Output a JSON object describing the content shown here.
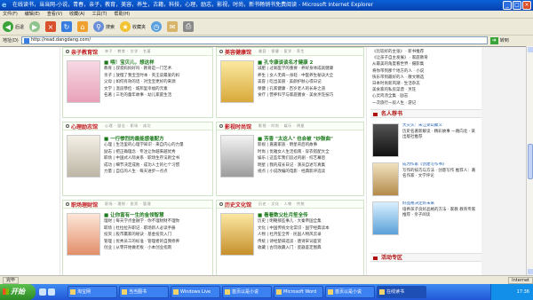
{
  "window": {
    "title": "在线读书，当当网-小说，青春，亲子，教育，美容，养生，古籍，科技，心理，励志，影视，时尚，新书畅销书免费阅读 - Microsoft Internet Explorer",
    "icon_label": "e",
    "min": "_",
    "max": "□",
    "close": "×"
  },
  "menu": [
    "文件(F)",
    "编辑(E)",
    "查看(V)",
    "收藏(A)",
    "工具(T)",
    "帮助(H)"
  ],
  "toolbar": {
    "back": "后退",
    "search": "搜索",
    "favorites": "收藏夹"
  },
  "address": {
    "label": "地址(D)",
    "url": "http://read.dangdang.com/",
    "go": "转到"
  },
  "sections": [
    {
      "title": "亲子教育馆",
      "tags": "亲子 · 教育 · 文学 · 名著",
      "headline": "■ 喂！宝贝儿，想这样",
      "lines": [
        "教育 | 叔叔妈妈好吗 · 教育是一门艺术",
        "亲子 | 放慢了我宝宝时本 · 英王说最爱的妈",
        "父母 | 如何有效的话 · 对宝宝更好的来源",
        "文学 | 温良恭俭 · 城邦里幸福的元素",
        "名著 | 三毛的童年故事 · 幼儿家庭生活"
      ]
    },
    {
      "title": "美容健康馆",
      "tags": "美容 · 保健 · 医学 · 养生",
      "headline": "■ 孔令康谈谈名才健康 2",
      "lines": [
        "减肥 | 过氧医学的重要 · 养好身体成就健康",
        "养生 | 女人无病一身轻 · 中医养生秘诀大全",
        "美容 | 吃出美丽 · 美颜护肤心得日记",
        "保健 | 孔家健康 · 百岁老人的长寿之道",
        "食疗 | 营养科学与家庭膳食 · 美食烹饪技巧"
      ]
    },
    {
      "title": "心理励志馆",
      "tags": "心理 · 励志 · 职场 · 成功",
      "headline": "■ 一行惨烈的最能感催配方",
      "lines": [
        "心理 | 生活里的心理学知识 · 来自内心的力量",
        "励志 | 把正确理念 · 专注让你越来越优秀",
        "职场 | 中国式人际关系 · 职场生存法则全书",
        "成功 | 细节决定成败 · 成功人士的七个习惯",
        "力量 | 自信的人生 · 每天进步一点点"
      ]
    },
    {
      "title": "影视时尚馆",
      "tags": "影视 · 时尚 · 娱乐 · 明星",
      "headline": "■ 芳香 \"太这人\" 也会被 \"炒鼓曲\"",
      "lines": [
        "影视 | 嘉嘉家族 · 明星背后的故事",
        "时尚 | 优雅女人生活指南 · 穿衣搭配大全",
        "娱乐 | 这些年我们追过的剧 · 综艺幕后",
        "明星 | 我的成长日记 · 演员自述写真集",
        "视点 | 小说改编的电影 · 经典影评选读"
      ]
    },
    {
      "title": "职场理财馆",
      "tags": "职场 · 理财 · 投资 · 管理",
      "headline": "■ 让你富有一生的金领智慧",
      "lines": [
        "理财 | 每天学点金融学 · 你不理财财不理你",
        "职场 | 杜拉拉升职记 · 职场新人必读手册",
        "投资 | 股市赢家的秘诀 · 基金投资入门",
        "管理 | 优秀员工的标准 · 管理者的自我修养",
        "创业 | 从零开始做老板 · 小本创业指南"
      ]
    },
    {
      "title": "历史文化馆",
      "tags": "历史 · 文化 · 人物 · 传统",
      "headline": "■ 看看数父杜月笙全传",
      "lines": [
        "历史 | 明朝那些事儿 · 大秦帝国全集",
        "文化 | 中国传统文化常识 · 国学经典读本",
        "人物 | 杜月笙全传 · 民国人物风云录",
        "传统 | 诗经楚辞选读 · 唐诗宋词鉴赏",
        "收藏 | 古玩收藏入门 · 瓷器鉴定图典"
      ]
    }
  ],
  "right": {
    "list": [
      "《比较好的主张》 · 新书推荐",
      "《让孩子自主发展》 · 家庭教育",
      "从最美的角度看世界 · 摄影集",
      "将你带到那个地方的人 · 小说",
      "快乐带到最好的人 · 散文精选",
      "日本时尚新风潮 · 生活杂志",
      "美食家的私房菜谱 · 烹饪",
      "心灵鸡汤全集 · 励志",
      "一次旅行一段人生 · 游记"
    ],
    "celebrity_title": "名人荐书",
    "picks": [
      {
        "title": "大灾头：宋江梁山聚义",
        "desc": "历史名著新解读 · 精彩故事",
        "author": "一路向北 · 某出版社推荐"
      },
      {
        "title": "成为作家《创建写作书》",
        "desc": "写作的技巧与方法 · 创意写作",
        "author": "推荐人：著名作家 · 文学评论"
      },
      {
        "title": "好品格决定好未来",
        "desc": "培养孩子良好品格的方法 · 家教",
        "author": "教育专家推荐 · 亲子阅读"
      }
    ],
    "activity_title": "活动专区"
  },
  "status": {
    "text": "完毕",
    "zone": "Internet"
  },
  "taskbar": {
    "start": "开始",
    "tasks": [
      "淘宝网",
      "当当图书",
      "Windows Live",
      "首页以是小说",
      "Microsoft Word",
      "首页以是小说",
      "在线读书"
    ],
    "time": "17:36"
  },
  "colors": {
    "section_title": "#c0181e",
    "headline": "#1c7a1c",
    "link": "#1f5fb0"
  }
}
